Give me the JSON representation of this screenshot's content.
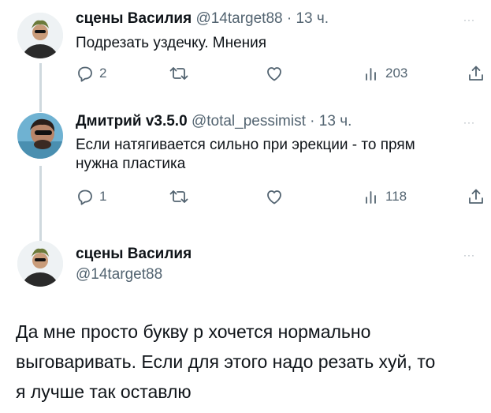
{
  "tweet1": {
    "name": "сцены Василия",
    "handle": "@14target88",
    "dot": "·",
    "time": "13 ч.",
    "text": "Подрезать уздечку. Мнения",
    "replies": "2",
    "views": "203"
  },
  "tweet2": {
    "name": "Дмитрий v3.5.0",
    "handle": "@total_pessimist",
    "dot": "·",
    "time": "13 ч.",
    "text_line1": "Если натягивается сильно при эрекции - то прям",
    "text_line2": "нужна пластика",
    "replies": "1",
    "views": "118"
  },
  "tweet3": {
    "name": "сцены Василия",
    "handle": "@14target88",
    "text_line1": "Да мне просто букву р хочется нормально",
    "text_line2": "выговаривать. Если для этого надо резать хуй, то",
    "text_line3": "я лучше так оставлю"
  },
  "more_label": "···",
  "colors": {
    "text": "#0f1419",
    "secondary": "#536471",
    "thread_line": "#cfd9de"
  },
  "icons": [
    "reply-icon",
    "retweet-icon",
    "like-icon",
    "views-icon",
    "share-icon",
    "more-icon"
  ]
}
